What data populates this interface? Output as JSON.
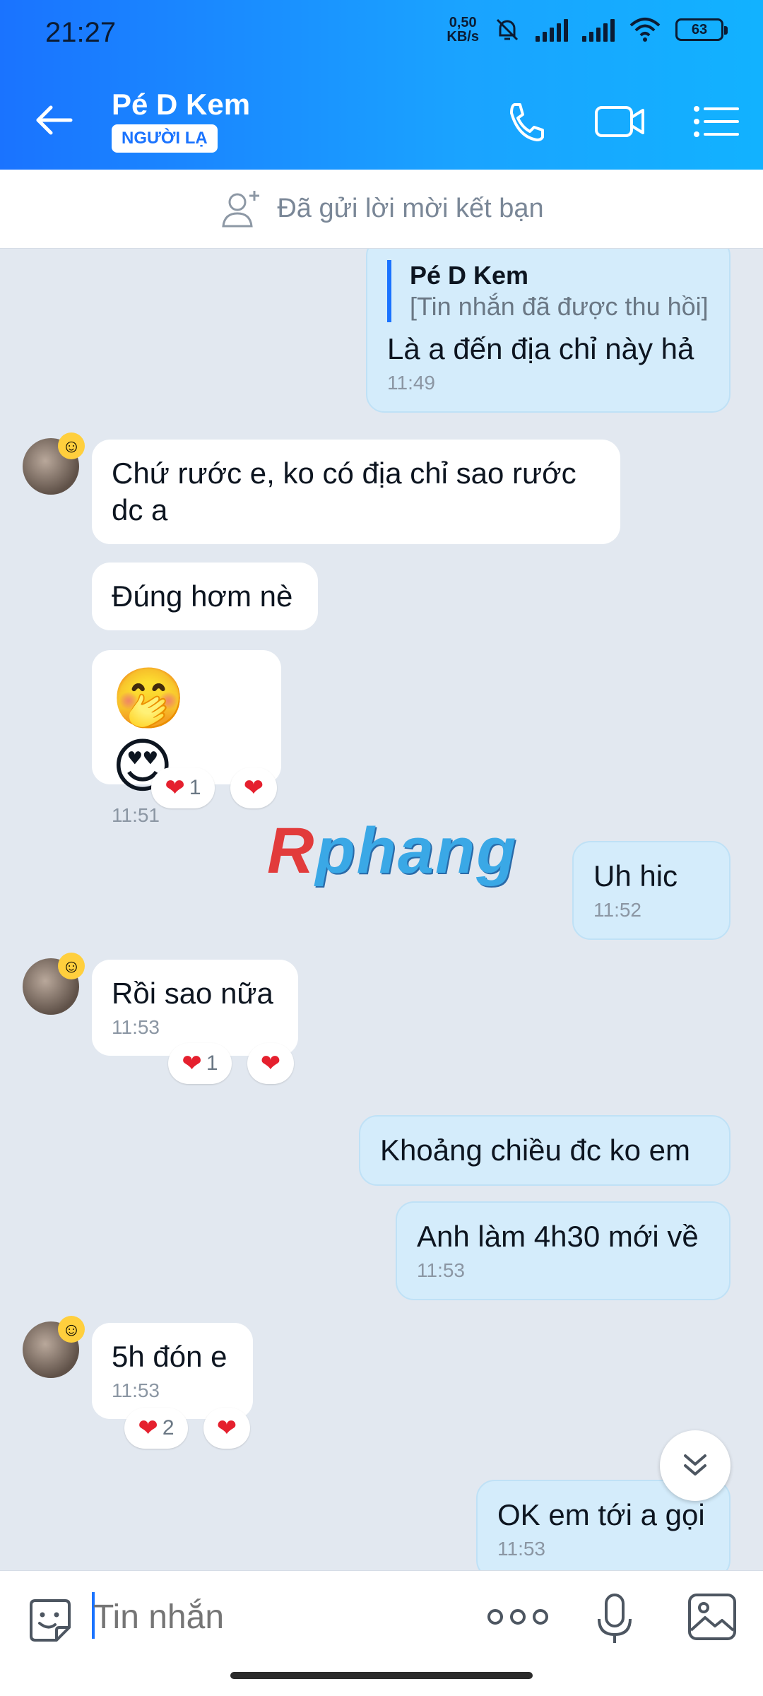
{
  "status_bar": {
    "time": "21:27",
    "net_speed_top": "0,50",
    "net_speed_bottom": "KB/s",
    "battery": "63"
  },
  "header": {
    "contact_name": "Pé D Kem",
    "badge": "NGƯỜI LẠ"
  },
  "friend_bar": {
    "text": "Đã gửi lời mời kết bạn"
  },
  "messages": [
    {
      "side": "me",
      "reply_name": "Pé D Kem",
      "reply_text": "[Tin nhắn đã được thu hồi]",
      "text": "Là a đến địa chỉ này hả",
      "time": "11:49"
    },
    {
      "side": "them",
      "text": "Chứ rước e, ko có địa chỉ sao rước dc a"
    },
    {
      "side": "them",
      "text": "Đúng hơm nè"
    },
    {
      "side": "them",
      "emoji": "🤭 😍",
      "time": "11:51",
      "reaction_count": "1"
    },
    {
      "side": "me",
      "text": "Uh hic",
      "time": "11:52"
    },
    {
      "side": "them",
      "text": "Rồi sao nữa",
      "time": "11:53",
      "reaction_count": "1"
    },
    {
      "side": "me",
      "text": "Khoảng chiều đc ko em"
    },
    {
      "side": "me",
      "text": "Anh làm 4h30 mới về",
      "time": "11:53"
    },
    {
      "side": "them",
      "text": "5h đón e",
      "time": "11:53",
      "reaction_count": "2"
    },
    {
      "side": "me",
      "text": "OK em tới a gọi",
      "time": "11:53"
    }
  ],
  "watermark": {
    "first": "R",
    "rest": "phang"
  },
  "composer": {
    "placeholder": "Tin nhắn"
  },
  "icons": {
    "back": "arrow-left-icon",
    "call": "phone-icon",
    "video": "video-camera-icon",
    "menu": "list-menu-icon",
    "add_friend": "add-user-icon",
    "scroll_down": "chevron-double-down-icon",
    "sticker": "sticker-face-icon",
    "more": "more-dots-icon",
    "mic": "microphone-icon",
    "image": "image-icon"
  },
  "colors": {
    "header_start": "#1a73ff",
    "header_end": "#12b2ff",
    "my_bubble": "#d4ecfb",
    "their_bubble": "#ffffff",
    "heart": "#e5202e"
  }
}
